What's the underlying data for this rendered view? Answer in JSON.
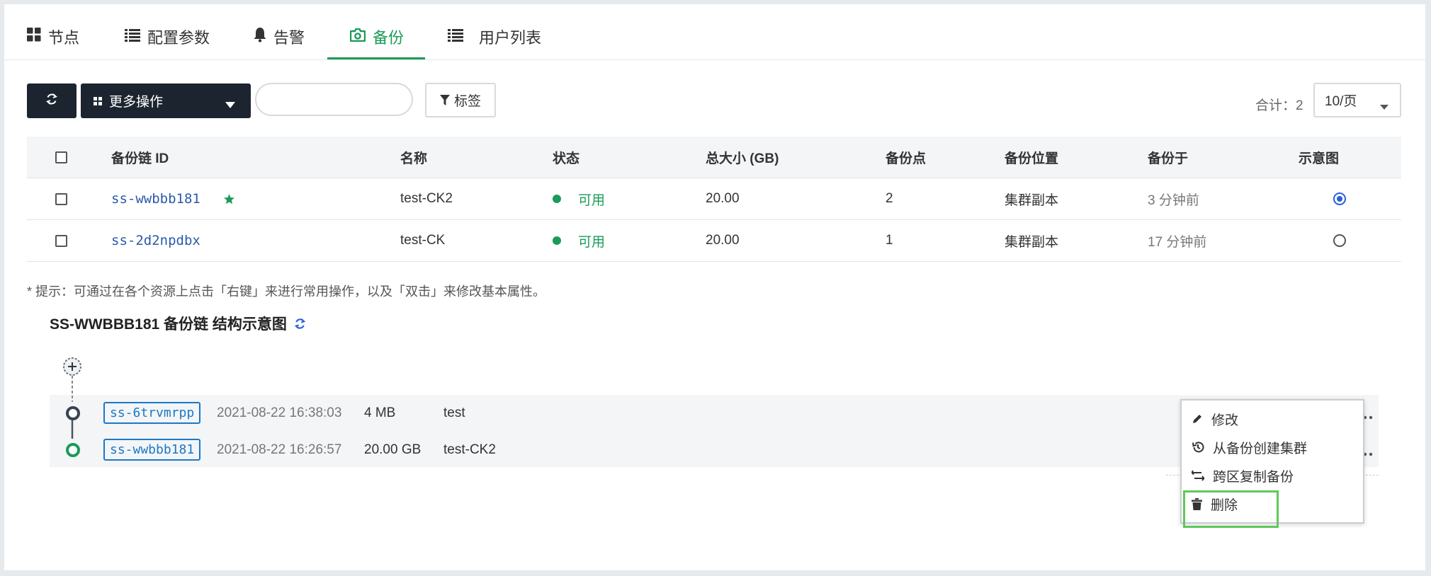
{
  "tabs": [
    {
      "label": "节点",
      "icon": "grid-icon"
    },
    {
      "label": "配置参数",
      "icon": "list-icon"
    },
    {
      "label": "告警",
      "icon": "bell-icon"
    },
    {
      "label": "备份",
      "icon": "camera-icon",
      "active": true
    },
    {
      "label": "用户列表",
      "icon": "list-icon"
    }
  ],
  "toolbar": {
    "more_actions_label": "更多操作",
    "search_value": "",
    "tag_label": "标签",
    "total_label": "合计：2",
    "page_size": "10/页"
  },
  "table": {
    "headers": [
      "备份链 ID",
      "名称",
      "状态",
      "总大小 (GB)",
      "备份点",
      "备份位置",
      "备份于",
      "示意图"
    ],
    "rows": [
      {
        "id": "ss-wwbbb181",
        "starred": true,
        "name": "test-CK2",
        "status": "可用",
        "size": "20.00",
        "points": "2",
        "location": "集群副本",
        "time": "3 分钟前",
        "selected": true
      },
      {
        "id": "ss-2d2npdbx",
        "starred": false,
        "name": "test-CK",
        "status": "可用",
        "size": "20.00",
        "points": "1",
        "location": "集群副本",
        "time": "17 分钟前",
        "selected": false
      }
    ]
  },
  "hint": "* 提示：可通过在各个资源上点击「右键」来进行常用操作，以及「双击」来修改基本属性。",
  "diagram": {
    "title": "SS-WWBBB181 备份链 结构示意图",
    "nodes": [
      {
        "id": "ss-6trvmrpp",
        "time": "2021-08-22 16:38:03",
        "size": "4 MB",
        "name": "test"
      },
      {
        "id": "ss-wwbbb181",
        "time": "2021-08-22 16:26:57",
        "size": "20.00 GB",
        "name": "test-CK2"
      }
    ]
  },
  "context_menu": {
    "items": [
      {
        "label": "修改",
        "icon": "pencil-icon"
      },
      {
        "label": "从备份创建集群",
        "icon": "history-icon"
      },
      {
        "label": "跨区复制备份",
        "icon": "transfer-icon"
      },
      {
        "label": "删除",
        "icon": "trash-icon"
      }
    ]
  },
  "colors": {
    "accent": "#1c9b58",
    "link": "#2a5aa8",
    "node_border": "#1b78c8",
    "dark_button": "#1c2430",
    "highlight": "#5fc85a"
  }
}
